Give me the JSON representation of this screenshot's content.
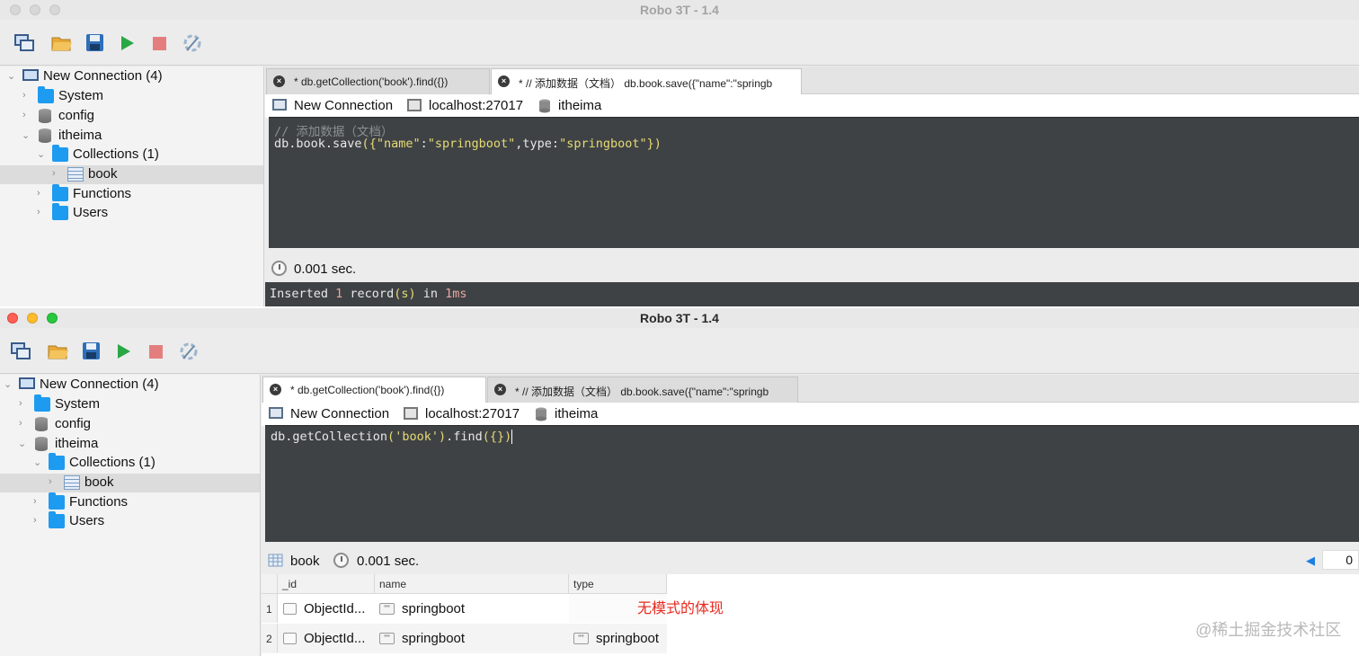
{
  "app": {
    "title": "Robo 3T - 1.4"
  },
  "colors": {
    "editor_bg": "#3f4245",
    "string": "#e6db74",
    "comment": "#8b8f93",
    "annotation": "#e8281e",
    "folder": "#1d9bf0"
  },
  "toolbar": {
    "icons": [
      "connect-icon",
      "open-icon",
      "save-icon",
      "run-icon",
      "stop-icon",
      "format-icon"
    ]
  },
  "tree": {
    "connection": "New Connection (4)",
    "system": "System",
    "config": "config",
    "database": "itheima",
    "collections": "Collections (1)",
    "collection": "book",
    "functions": "Functions",
    "users": "Users"
  },
  "tabs": {
    "find": "* db.getCollection('book').find({})",
    "save": "* // 添加数据（文档） db.book.save({\"name\":\"springb"
  },
  "connection_info": {
    "connection": "New Connection",
    "host": "localhost:27017",
    "db": "itheima"
  },
  "window1": {
    "editor": {
      "comment": "// 添加数据（文档）",
      "code_pre": "db.book.save",
      "code_p1": "(",
      "code_b1": "{",
      "code_s1": "\"name\"",
      "code_colon1": ":",
      "code_s2": "\"springboot\"",
      "code_mid": ",type:",
      "code_s3": "\"springboot\"",
      "code_b2": "}",
      "code_p2": ")"
    },
    "status": {
      "time": "0.001 sec."
    },
    "output": {
      "w1": "Inserted ",
      "n1": "1",
      "w2": " record",
      "p": "(s)",
      "w3": " in ",
      "n2": "1ms"
    }
  },
  "window2": {
    "editor": {
      "code_pre": "db.getCollection",
      "code_p1": "(",
      "code_s1": "'book'",
      "code_p2": ")",
      "code_mid": ".find",
      "code_p3": "(",
      "code_b": "{}",
      "code_p4": ")"
    },
    "result": {
      "collection": "book",
      "time": "0.001 sec.",
      "page": "0"
    },
    "grid": {
      "columns": [
        "_id",
        "name",
        "type"
      ],
      "rows": [
        {
          "num": "1",
          "id": "ObjectId...",
          "name": "springboot",
          "type": ""
        },
        {
          "num": "2",
          "id": "ObjectId...",
          "name": "springboot",
          "type": "springboot"
        }
      ]
    },
    "annotation": "无模式的体现"
  },
  "watermark": "@稀土掘金技术社区"
}
